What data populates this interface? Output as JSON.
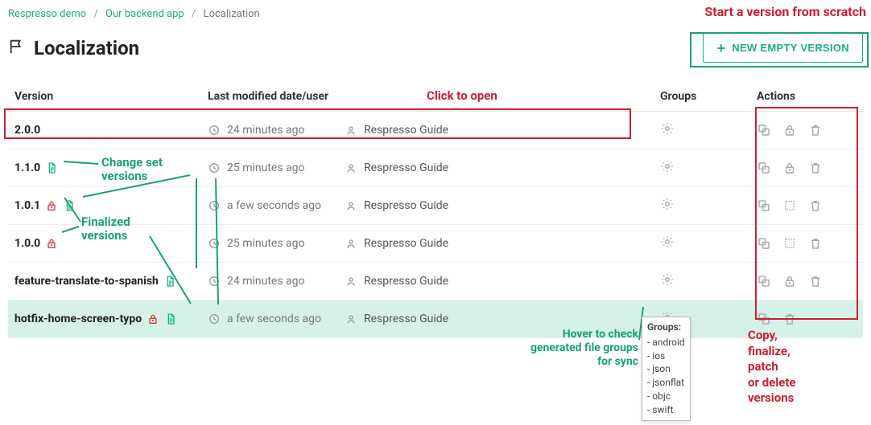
{
  "breadcrumb": {
    "items": [
      "Respresso demo",
      "Our backend app",
      "Localization"
    ]
  },
  "page_title": "Localization",
  "new_button_label": "NEW EMPTY VERSION",
  "columns": {
    "version": "Version",
    "modified": "Last modified date/user",
    "groups": "Groups",
    "actions": "Actions"
  },
  "rows": [
    {
      "version": "2.0.0",
      "badges": [],
      "modified": "24 minutes ago",
      "user": "Respresso Guide",
      "actions": [
        "copy",
        "lock",
        "delete"
      ]
    },
    {
      "version": "1.1.0",
      "badges": [
        "changeset"
      ],
      "modified": "25 minutes ago",
      "user": "Respresso Guide",
      "actions": [
        "copy",
        "lock",
        "delete"
      ]
    },
    {
      "version": "1.0.1",
      "badges": [
        "finalized",
        "changeset"
      ],
      "modified": "a few seconds ago",
      "user": "Respresso Guide",
      "actions": [
        "copy",
        "patch",
        "delete"
      ]
    },
    {
      "version": "1.0.0",
      "badges": [
        "finalized"
      ],
      "modified": "25 minutes ago",
      "user": "Respresso Guide",
      "actions": [
        "copy",
        "patch",
        "delete"
      ]
    },
    {
      "version": "feature-translate-to-spanish",
      "badges": [
        "changeset"
      ],
      "modified": "24 minutes ago",
      "user": "Respresso Guide",
      "actions": [
        "copy",
        "lock",
        "delete"
      ]
    },
    {
      "version": "hotfix-home-screen-typo",
      "badges": [
        "finalized",
        "changeset"
      ],
      "modified": "a few seconds ago",
      "user": "Respresso Guide",
      "actions": [
        "copy",
        "delete"
      ],
      "highlight": true
    }
  ],
  "tooltip": {
    "title": "Groups:",
    "items": [
      "android",
      "ios",
      "json",
      "jsonflat",
      "objc",
      "swift"
    ]
  },
  "annotations": {
    "start_scratch": "Start a version from scratch",
    "click_open": "Click to open",
    "changeset": "Change set versions",
    "finalized": "Finalized versions",
    "hover_groups": "Hover to check generated file groups for sync",
    "actions_desc": "Copy, finalize, patch or delete versions"
  }
}
